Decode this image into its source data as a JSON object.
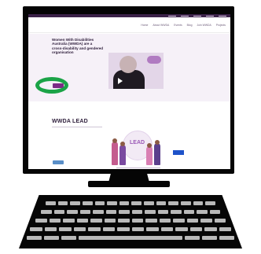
{
  "monitor": {
    "top_strip_links": [
      "",
      "",
      "",
      "",
      ""
    ],
    "nav": {
      "items": [
        "Home",
        "About WWDA",
        "Events",
        "Blog",
        "Join WWDA",
        "Projects"
      ]
    },
    "hero": {
      "title": "Women With Disabilities Australia (WWDA) are a cross-disability and gendered organisation",
      "subtitle": "",
      "button_label": "",
      "video": {
        "has_play_button": true
      }
    },
    "annotation": {
      "highlight_color": "#1ba347"
    },
    "section": {
      "kicker": "",
      "title": "WWDA LEAD",
      "subheading": "",
      "body": "",
      "button_label": "",
      "illustration_word": "LEAD"
    },
    "colors": {
      "brand_purple": "#3b2148",
      "accent_purple": "#7c2b86",
      "link_blue": "#5a8fc8",
      "marker_blue": "#1e52c9"
    }
  }
}
